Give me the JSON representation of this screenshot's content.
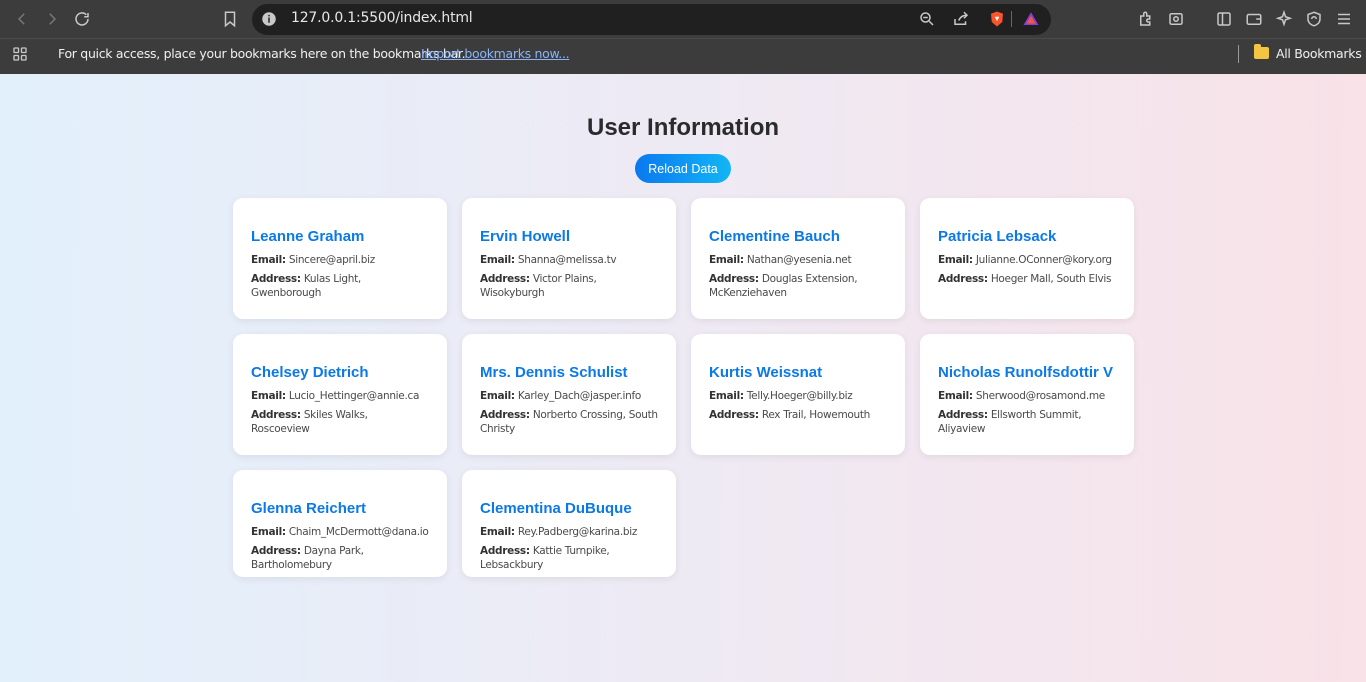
{
  "browser": {
    "url": "127.0.0.1:5500/index.html",
    "bookmarks_message": "For quick access, place your bookmarks here on the bookmarks bar.",
    "import_link": "Import bookmarks now...",
    "all_bookmarks": "All Bookmarks"
  },
  "page": {
    "title": "User Information",
    "reload_label": "Reload Data",
    "email_label": "Email:",
    "address_label": "Address:"
  },
  "users": [
    {
      "name": "Leanne Graham",
      "email": "Sincere@april.biz",
      "address": "Kulas Light, Gwenborough"
    },
    {
      "name": "Ervin Howell",
      "email": "Shanna@melissa.tv",
      "address": "Victor Plains, Wisokyburgh"
    },
    {
      "name": "Clementine Bauch",
      "email": "Nathan@yesenia.net",
      "address": "Douglas Extension, McKenziehaven"
    },
    {
      "name": "Patricia Lebsack",
      "email": "Julianne.OConner@kory.org",
      "address": "Hoeger Mall, South Elvis"
    },
    {
      "name": "Chelsey Dietrich",
      "email": "Lucio_Hettinger@annie.ca",
      "address": "Skiles Walks, Roscoeview"
    },
    {
      "name": "Mrs. Dennis Schulist",
      "email": "Karley_Dach@jasper.info",
      "address": "Norberto Crossing, South Christy"
    },
    {
      "name": "Kurtis Weissnat",
      "email": "Telly.Hoeger@billy.biz",
      "address": "Rex Trail, Howemouth"
    },
    {
      "name": "Nicholas Runolfsdottir V",
      "email": "Sherwood@rosamond.me",
      "address": "Ellsworth Summit, Aliyaview"
    },
    {
      "name": "Glenna Reichert",
      "email": "Chaim_McDermott@dana.io",
      "address": "Dayna Park, Bartholomebury"
    },
    {
      "name": "Clementina DuBuque",
      "email": "Rey.Padberg@karina.biz",
      "address": "Kattie Turnpike, Lebsackbury"
    }
  ]
}
